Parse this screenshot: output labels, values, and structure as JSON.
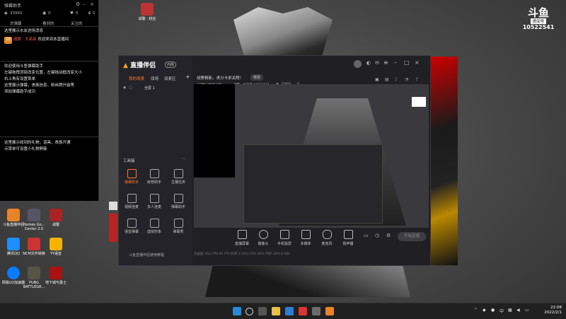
{
  "danmaku": {
    "title": "弹幕助手",
    "stats": [
      "33950",
      "0",
      "0",
      "0"
    ],
    "tabs": [
      "总弹幕",
      "看到的",
      "关注的"
    ],
    "messages": [
      {
        "text": "这里展示水友进场消息"
      },
      {
        "badge": "10",
        "user": "战狼 · 大亮亮",
        "text": "欢迎来到本直播间"
      },
      {
        "text": "欢迎使用斗鱼弹幕助手"
      },
      {
        "text": "左键拖拽顶部改变位置，左键拖动框改变大小"
      },
      {
        "text": "右上角有设置菜单"
      },
      {
        "text": "这里展示弹幕，贵族信息，粉丝牌升级等"
      },
      {
        "text": "添加弹幕助手成功"
      },
      {
        "text": "这里展示收到的礼物，道具，贵族开通"
      },
      {
        "text": "点菜单可设置小礼物屏蔽"
      }
    ]
  },
  "douyu_logo": {
    "brand": "斗鱼",
    "room_label": "房间号",
    "room_id": "10522541"
  },
  "desktop_icons": [
    {
      "label": "战警 · 粉丝",
      "color": "#b33"
    },
    {
      "label": "斗鱼直播伴侣",
      "color": "#e8832a"
    },
    {
      "label": "Heroes Go... Center 2.0",
      "color": "#556"
    },
    {
      "label": "战警",
      "color": "#a22"
    },
    {
      "label": "腾讯QQ",
      "color": "#1e8fff"
    },
    {
      "label": "NCM文件转换",
      "color": "#c33"
    },
    {
      "label": "YY语音",
      "color": "#f5b400"
    },
    {
      "label": "网易UU加速器",
      "color": "#0a7cff"
    },
    {
      "label": "PUBG BATTLEGR...",
      "color": "#554"
    },
    {
      "label": "地下城与勇士",
      "color": "#a11"
    }
  ],
  "app": {
    "brand": "直播伴侣",
    "version_badge": "内侧",
    "tabs": [
      "我的场景",
      "双场",
      "双麦区"
    ],
    "scene_label": "全屏 1",
    "announcement": "战警精新，求分卡求关照！",
    "edit_label": "修改",
    "room_tag": "战警 · 传说之子",
    "room_info": "战警 · 大美丰  10522541",
    "viewers": "33950",
    "likes": "0",
    "tool_section": "工具箱",
    "tools": [
      "弹幕助手",
      "房管助手",
      "主播任务",
      "视频连麦",
      "多人连麦",
      "弹幕助手",
      "语音弹幕",
      "虚拟形象",
      "弹幕秀",
      "斗鱼直播伴侣使用教程"
    ],
    "bottom_tools": [
      "直播屏幕",
      "摄像头",
      "手机投屏",
      "多媒体",
      "麦克风",
      "扬声器"
    ],
    "start_live": "开始直播",
    "status": "无画面 0fps  FPS:60  FPS 码率 0 (0%)  CPU:46%  内存:39%  0.00k"
  },
  "taskbar": {
    "time": "22:08",
    "date": "2022/2/1",
    "tray_lang": "中"
  }
}
